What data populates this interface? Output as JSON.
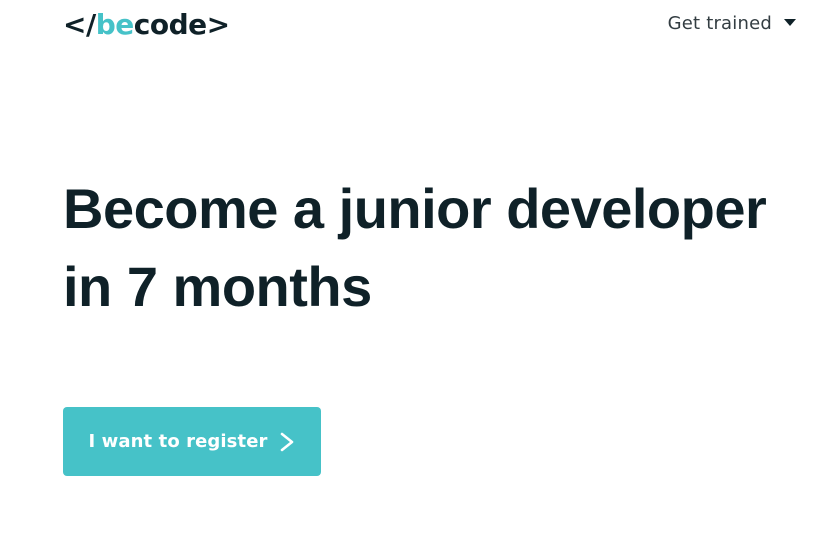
{
  "header": {
    "logo": {
      "bracket_open": "</",
      "accent": "be",
      "rest": "code",
      "bracket_close": ">"
    },
    "nav": {
      "dropdown_label": "Get trained",
      "dropdown_icon": "caret-down-icon"
    }
  },
  "hero": {
    "title_line1": "Become a junior developer",
    "title_line2": "in 7 months",
    "cta": {
      "label": "I want to register",
      "icon": "chevron-right-icon"
    }
  },
  "colors": {
    "accent": "#46c2c8",
    "text_dark": "#0f2128",
    "background": "#ffffff"
  }
}
